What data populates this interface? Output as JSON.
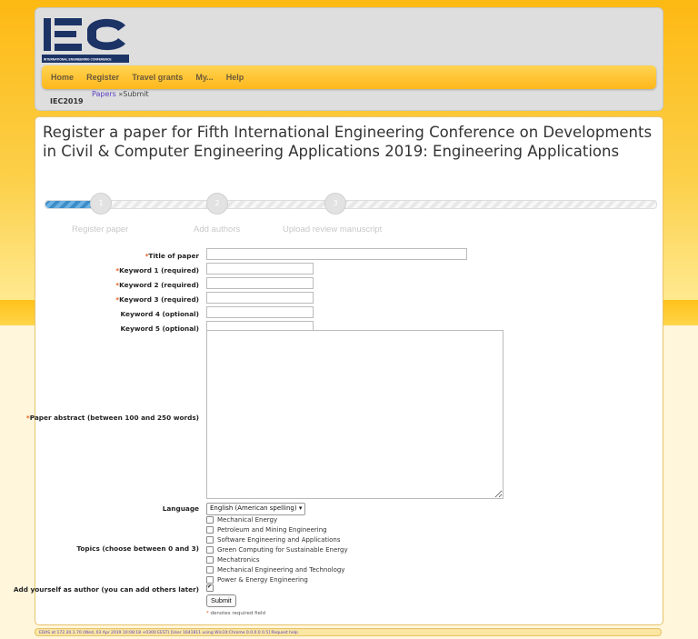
{
  "logo": {
    "letters": "IEC",
    "tagline": "INTERNATIONAL ENGINEERING CONFERENCE",
    "color": "#1c3366"
  },
  "nav": {
    "items": [
      "Home",
      "Register",
      "Travel grants",
      "My...",
      "Help"
    ]
  },
  "conference_tag": "IEC2019",
  "breadcrumb": {
    "link": "Papers",
    "separator": " »",
    "current": "Submit"
  },
  "page_title": "Register a paper for Fifth International Engineering Conference on Developments in Civil & Computer Engineering Applications 2019: Engineering Applications",
  "steps": [
    {
      "number": "1",
      "label": "Register paper"
    },
    {
      "number": "2",
      "label": "Add authors"
    },
    {
      "number": "3",
      "label": "Upload review manuscript"
    }
  ],
  "progress": {
    "fraction": 0.08,
    "fill_color": "#3c8dc8"
  },
  "form": {
    "required_marker": "*",
    "title_label": "Title of paper",
    "title_value": "",
    "keywords": [
      {
        "label": "Keyword 1 (required)",
        "required": true,
        "value": ""
      },
      {
        "label": "Keyword 2 (required)",
        "required": true,
        "value": ""
      },
      {
        "label": "Keyword 3 (required)",
        "required": true,
        "value": ""
      },
      {
        "label": "Keyword 4 (optional)",
        "required": false,
        "value": ""
      },
      {
        "label": "Keyword 5 (optional)",
        "required": false,
        "value": ""
      }
    ],
    "abstract_label": "Paper abstract (between 100 and 250 words)",
    "abstract_value": "",
    "language_label": "Language",
    "language_value": "English (American spelling)",
    "topics_label": "Topics (choose between 0 and 3)",
    "topics": [
      "Mechanical Energy",
      "Petroleum and Mining Engineering",
      "Software Engineering and Applications",
      "Green Computing for Sustainable Energy",
      "Mechatronics",
      "Mechanical Engineering and Technology",
      "Power & Energy Engineering"
    ],
    "add_author_label": "Add yourself as author (you can add others later)",
    "add_author_checked": true,
    "submit_label": "Submit",
    "required_note": "denotes required field"
  },
  "footer": "EDAS at 172.20.1.70 (Wed, 03 Apr 2019 10:08:18 +0300 EEST) [User 1641811 using Win10:Chrome 0.0.0.0 0.5] Request help"
}
